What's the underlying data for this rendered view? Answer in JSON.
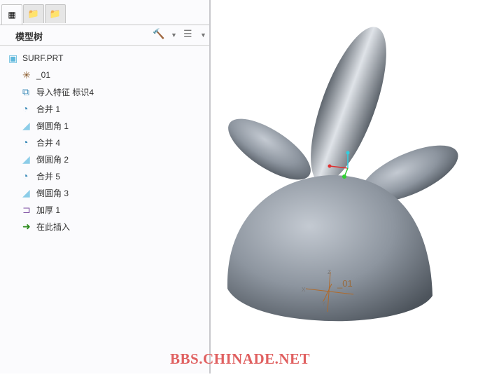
{
  "tabs": [
    {
      "name": "model-tree",
      "icon": "tree-icon"
    },
    {
      "name": "folder-browser",
      "icon": "folders-icon"
    },
    {
      "name": "favorites",
      "icon": "favorites-folder-icon"
    }
  ],
  "panel": {
    "title": "模型树",
    "settings_icon": "tools-icon",
    "show_icon": "list-icon"
  },
  "tree": [
    {
      "label": "SURF.PRT",
      "icon": "part-icon"
    },
    {
      "label": "_01",
      "icon": "coord-sys-icon"
    },
    {
      "label": "导入特征 标识4",
      "icon": "import-feature-icon"
    },
    {
      "label": "合并 1",
      "icon": "merge-icon"
    },
    {
      "label": "倒圆角 1",
      "icon": "round-icon"
    },
    {
      "label": "合并 4",
      "icon": "merge-icon"
    },
    {
      "label": "倒圆角 2",
      "icon": "round-icon"
    },
    {
      "label": "合并 5",
      "icon": "merge-icon"
    },
    {
      "label": "倒圆角 3",
      "icon": "round-icon"
    },
    {
      "label": "加厚 1",
      "icon": "thicken-icon"
    },
    {
      "label": "在此插入",
      "icon": "insert-here-arrow-icon"
    }
  ],
  "viewport": {
    "csys_label": "_01",
    "axis_z": "Z",
    "axis_x": "X",
    "axis_y": "Y"
  },
  "watermark": "BBS.CHINADE.NET",
  "colors": {
    "model": "#8a929c",
    "csys": "#b06a2a"
  }
}
